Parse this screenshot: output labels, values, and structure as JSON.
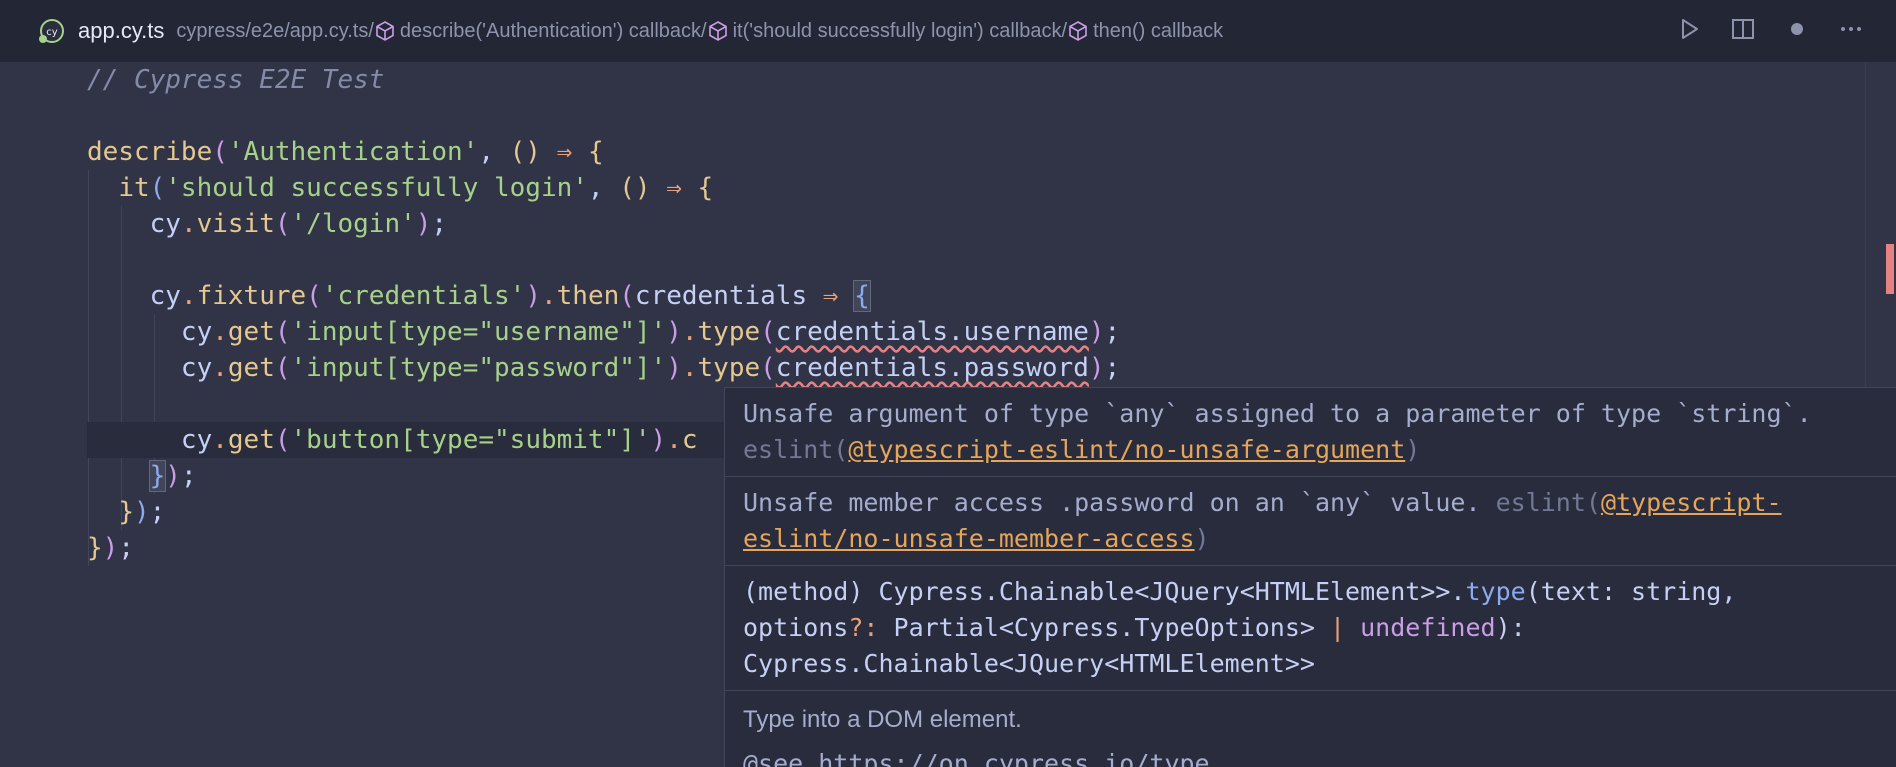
{
  "tab": {
    "title": "app.cy.ts"
  },
  "breadcrumb": {
    "path": "cypress/e2e/app.cy.ts/",
    "items": [
      "describe('Authentication') callback/",
      "it('should successfully login') callback/",
      "then() callback"
    ]
  },
  "actions": [
    "play-icon",
    "split-editor-icon",
    "dot-icon",
    "more-icon"
  ],
  "code": {
    "l1": "// Cypress E2E Test",
    "l3_fn": "describe",
    "l3_str": "'Authentication'",
    "l4_fn": "it",
    "l4_str": "'should successfully login'",
    "l5_obj": "cy",
    "l5_fn": "visit",
    "l5_str": "'/login'",
    "l7_obj": "cy",
    "l7_fn": "fixture",
    "l7_str": "'credentials'",
    "l7_fn2": "then",
    "l7_param": "credentials",
    "l8_str": "'input[type=\"username\"]'",
    "l8_prop": "credentials.username",
    "l9_str": "'input[type=\"password\"]'",
    "l9_prop": "credentials.password",
    "l11_str": "'button[type=\"submit\"]'",
    "l11_tail": "c"
  },
  "hover": {
    "msg1_text": "Unsafe argument of type `any` assigned to a parameter of type `string`.",
    "msg1_src": "eslint(",
    "msg1_rule": "@typescript-eslint/no-unsafe-argument",
    "msg1_close": ")",
    "msg2_text": "Unsafe member access .password on an `any` value.",
    "msg2_src": "eslint(",
    "msg2_rule1": "@typescript-",
    "msg2_rule2": "eslint/no-unsafe-member-access",
    "msg2_close": ")",
    "sig_line1_a": "(method) Cypress.Chainable<JQuery<HTMLElement>>.",
    "sig_line1_fn": "type",
    "sig_line1_b": "(text: string,",
    "sig_line2_a": "options",
    "sig_line2_q": "?:",
    "sig_line2_b": " Partial<Cypress.TypeOptions> ",
    "sig_line2_pipe": "|",
    "sig_line2_kw": " undefined",
    "sig_line2_c": "):",
    "sig_line3": "Cypress.Chainable<JQuery<HTMLElement>>",
    "doc": "Type into a DOM element.",
    "doc_partial": "@see https://on.cypress.io/type"
  },
  "colors": {
    "error": "#e78284",
    "accent": "#e5c890"
  }
}
